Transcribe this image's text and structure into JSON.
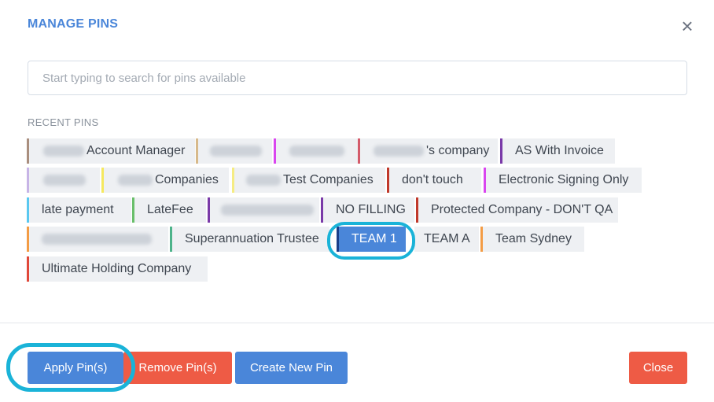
{
  "dialog": {
    "title": "MANAGE PINS",
    "close_icon": "close-icon"
  },
  "search": {
    "placeholder": "Start typing to search for pins available",
    "value": ""
  },
  "recent_label": "RECENT PINS",
  "pins": [
    {
      "label": "Account Manager",
      "color": "#a98e7e",
      "redacted": true
    },
    {
      "label": "",
      "color": "#d7b98a",
      "redacted": true
    },
    {
      "label": "",
      "color": "#d946ef",
      "redacted": true
    },
    {
      "label": "'s company",
      "color": "#d45b6a",
      "redacted": true
    },
    {
      "label": "AS With Invoice",
      "color": "#7a3aa8",
      "redacted": false
    },
    {
      "label": "",
      "color": "#c7b4e6",
      "redacted": true
    },
    {
      "label": "Companies",
      "color": "#f5e85f",
      "redacted": true
    },
    {
      "label": "Test Companies",
      "color": "#f5ec83",
      "redacted": true
    },
    {
      "label": "don't touch",
      "color": "#c0392b",
      "redacted": false
    },
    {
      "label": "Electronic Signing Only",
      "color": "#d946ef",
      "redacted": false
    },
    {
      "label": "late payment",
      "color": "#5ac8f0",
      "redacted": false
    },
    {
      "label": "LateFee",
      "color": "#6abf6b",
      "redacted": false
    },
    {
      "label": "",
      "color": "#7a3aa8",
      "redacted": true
    },
    {
      "label": "NO FILLING",
      "color": "#7a3aa8",
      "redacted": false
    },
    {
      "label": "Protected Company - DON'T QA",
      "color": "#c0392b",
      "redacted": false
    },
    {
      "label": "",
      "color": "#f39c45",
      "redacted": true
    },
    {
      "label": "Superannuation Trustee",
      "color": "#4db38a",
      "redacted": false
    },
    {
      "label": "TEAM 1",
      "color": "#1a3f8a",
      "redacted": false,
      "selected": true
    },
    {
      "label": "TEAM A",
      "color": "#ffffff",
      "redacted": false
    },
    {
      "label": "Team Sydney",
      "color": "#f39c45",
      "redacted": false
    },
    {
      "label": "Ultimate Holding Company",
      "color": "#e0483a",
      "redacted": false
    }
  ],
  "buttons": {
    "apply": "Apply Pin(s)",
    "remove": "Remove Pin(s)",
    "create": "Create New Pin",
    "close": "Close"
  }
}
